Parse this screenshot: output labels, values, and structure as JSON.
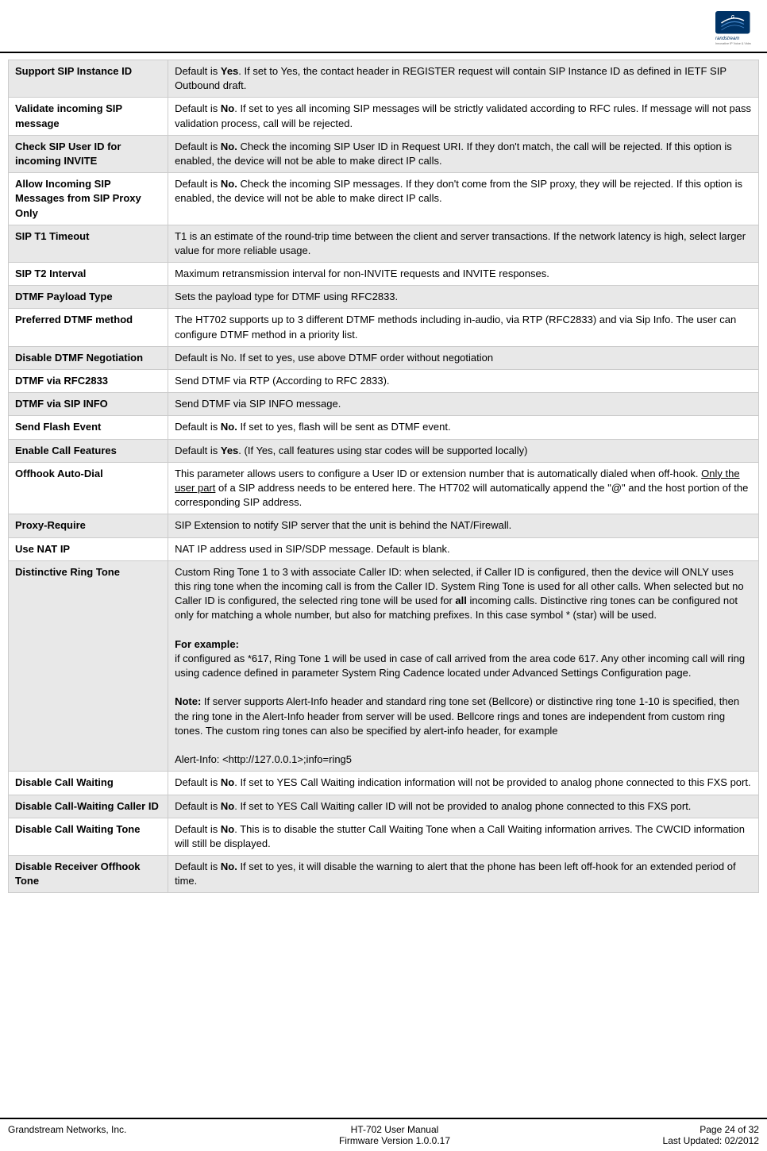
{
  "header": {
    "logo_alt": "Grandstream Logo"
  },
  "table": {
    "rows": [
      {
        "name": "Support SIP Instance ID",
        "desc": "Default is <b>Yes</b>. If set to Yes, the contact header in REGISTER request will contain SIP Instance ID as defined in IETF SIP Outbound draft."
      },
      {
        "name": "Validate incoming SIP message",
        "desc": "Default is <b>No</b>. If set to yes all incoming SIP messages will be strictly validated according to RFC rules. If message will not pass validation process, call will be rejected."
      },
      {
        "name": "Check SIP User ID for incoming INVITE",
        "desc": "Default is <b>No.</b> Check the incoming SIP User ID in Request URI. If they don't match, the call will be rejected. If this option is enabled, the device will not be able to make direct IP calls."
      },
      {
        "name": "Allow Incoming SIP Messages from SIP Proxy Only",
        "desc": "Default is <b>No.</b> Check the incoming SIP messages. If they don't come from the SIP proxy, they will be rejected. If this option is enabled, the device will not be able to make direct IP calls."
      },
      {
        "name": "SIP T1 Timeout",
        "desc": "T1 is an estimate of the round-trip time between the client and server transactions. If the network latency is high, select larger value for more reliable usage."
      },
      {
        "name": "SIP T2 Interval",
        "desc": "Maximum retransmission interval for non-INVITE requests and INVITE responses."
      },
      {
        "name": "DTMF Payload Type",
        "desc": "Sets the payload type for DTMF using RFC2833."
      },
      {
        "name": "Preferred DTMF method",
        "desc": "The HT702 supports up to 3 different DTMF methods including in-audio, via RTP (RFC2833) and via Sip Info. The user can configure DTMF method in a priority list."
      },
      {
        "name": "Disable DTMF Negotiation",
        "desc": "Default is No. If set to yes, use above DTMF order without negotiation"
      },
      {
        "name": "DTMF via RFC2833",
        "desc": "Send DTMF via RTP (According to RFC 2833)."
      },
      {
        "name": "DTMF via SIP INFO",
        "desc": "Send DTMF via SIP INFO message."
      },
      {
        "name": "Send Flash Event",
        "desc": "Default is <b>No.</b> If set to yes, flash will be sent as DTMF event."
      },
      {
        "name": "Enable Call Features",
        "desc": "Default is <b>Yes</b>. (If Yes, call features using star codes will be supported locally)"
      },
      {
        "name": "Offhook Auto-Dial",
        "desc": "This parameter allows users to configure a User ID or extension number that is automatically dialed when off-hook. <u>Only the user part</u> of a SIP address needs to be entered here. The HT702 will automatically append the \"@\" and the host portion of the corresponding SIP address."
      },
      {
        "name": "Proxy-Require",
        "desc": "SIP Extension to notify SIP server that the unit is behind the NAT/Firewall."
      },
      {
        "name": "Use NAT IP",
        "desc": "NAT IP address used in SIP/SDP message. Default is blank."
      },
      {
        "name": "Distinctive Ring Tone",
        "desc": "Custom Ring Tone 1 to 3 with associate Caller ID: when selected, if Caller ID is configured, then the device will ONLY uses this ring tone when the incoming call is from the Caller ID. System Ring Tone is used for all other calls. When selected but no Caller ID is configured, the selected ring tone will be used for <b>all</b> incoming calls. Distinctive ring tones can be configured not only for matching a whole number, but also for matching prefixes. In this case symbol * (star) will be used.<br><br><b>For example:</b><br> if configured as *617, Ring Tone 1 will be used in case of call arrived from the area code 617. Any other incoming call will ring using cadence defined in parameter System Ring Cadence located under Advanced Settings Configuration page.<br><br><b>Note:</b> If server supports Alert-Info header and standard ring tone set (Bellcore) or distinctive ring tone 1-10 is specified, then the ring tone in the Alert-Info header from server will be used. Bellcore rings and tones are independent from custom ring tones. The custom ring tones can also be specified by alert-info header, for example<br><br>Alert-Info: &lt;http://127.0.0.1&gt;;info=ring5"
      },
      {
        "name": "Disable Call Waiting",
        "desc": "Default is <b>No</b>. If set to YES Call Waiting indication information will not be provided to analog phone connected to this FXS port."
      },
      {
        "name": "Disable Call-Waiting Caller ID",
        "desc": "Default is <b>No</b>. If set to YES Call Waiting caller ID will not be provided to analog phone connected to this FXS port."
      },
      {
        "name": "Disable Call Waiting Tone",
        "desc": "Default is <b>No</b>. This is to disable the stutter Call Waiting Tone when a Call Waiting information arrives. The CWCID information will still be displayed."
      },
      {
        "name": "Disable Receiver Offhook Tone",
        "desc": "Default is <b>No.</b> If set to yes, it will disable the warning to alert that the phone has been left off-hook for an extended period of time."
      }
    ]
  },
  "footer": {
    "left": "Grandstream Networks, Inc.",
    "center_line1": "HT-702 User Manual",
    "center_line2": "Firmware Version 1.0.0.17",
    "right_line1": "Page 24 of 32",
    "right_line2": "Last Updated: 02/2012"
  }
}
